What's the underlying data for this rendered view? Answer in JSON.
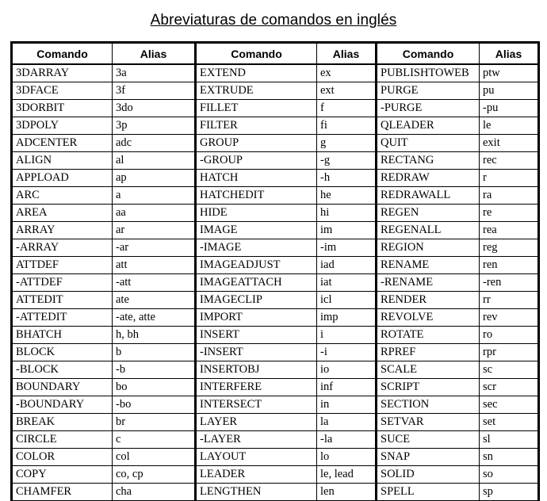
{
  "page": {
    "title": "Abreviaturas de comandos en inglés",
    "background_color": "#ffffff",
    "text_color": "#000000",
    "border_color": "#000000"
  },
  "table": {
    "headers": {
      "command": "Comando",
      "alias": "Alias"
    },
    "column_groups": [
      {
        "group_index": 1,
        "header_command": "Comando",
        "header_alias": "Alias",
        "rows": [
          {
            "command": "3DARRAY",
            "alias": "3a"
          },
          {
            "command": "3DFACE",
            "alias": "3f"
          },
          {
            "command": "3DORBIT",
            "alias": "3do"
          },
          {
            "command": "3DPOLY",
            "alias": "3p"
          },
          {
            "command": "ADCENTER",
            "alias": "adc"
          },
          {
            "command": "ALIGN",
            "alias": "al"
          },
          {
            "command": "APPLOAD",
            "alias": "ap"
          },
          {
            "command": "ARC",
            "alias": "a"
          },
          {
            "command": "AREA",
            "alias": "aa"
          },
          {
            "command": "ARRAY",
            "alias": "ar"
          },
          {
            "command": "-ARRAY",
            "alias": "-ar"
          },
          {
            "command": "ATTDEF",
            "alias": "att"
          },
          {
            "command": "-ATTDEF",
            "alias": "-att"
          },
          {
            "command": "ATTEDIT",
            "alias": "ate"
          },
          {
            "command": "-ATTEDIT",
            "alias": "-ate, atte"
          },
          {
            "command": "BHATCH",
            "alias": "h, bh"
          },
          {
            "command": "BLOCK",
            "alias": "b"
          },
          {
            "command": "-BLOCK",
            "alias": "-b"
          },
          {
            "command": "BOUNDARY",
            "alias": "bo"
          },
          {
            "command": "-BOUNDARY",
            "alias": "-bo"
          },
          {
            "command": "BREAK",
            "alias": "br"
          },
          {
            "command": "CIRCLE",
            "alias": "c"
          },
          {
            "command": "COLOR",
            "alias": "col"
          },
          {
            "command": "COPY",
            "alias": "co, cp"
          },
          {
            "command": "CHAMFER",
            "alias": "cha"
          }
        ]
      },
      {
        "group_index": 2,
        "header_command": "Comando",
        "header_alias": "Alias",
        "rows": [
          {
            "command": "EXTEND",
            "alias": "ex"
          },
          {
            "command": "EXTRUDE",
            "alias": "ext"
          },
          {
            "command": "FILLET",
            "alias": "f"
          },
          {
            "command": "FILTER",
            "alias": "fi"
          },
          {
            "command": "GROUP",
            "alias": "g"
          },
          {
            "command": "-GROUP",
            "alias": "-g"
          },
          {
            "command": "HATCH",
            "alias": "-h"
          },
          {
            "command": "HATCHEDIT",
            "alias": "he"
          },
          {
            "command": "HIDE",
            "alias": "hi"
          },
          {
            "command": "IMAGE",
            "alias": "im"
          },
          {
            "command": "-IMAGE",
            "alias": "-im"
          },
          {
            "command": "IMAGEADJUST",
            "alias": "iad"
          },
          {
            "command": "IMAGEATTACH",
            "alias": "iat"
          },
          {
            "command": "IMAGECLIP",
            "alias": "icl"
          },
          {
            "command": "IMPORT",
            "alias": "imp"
          },
          {
            "command": "INSERT",
            "alias": "i"
          },
          {
            "command": "-INSERT",
            "alias": "-i"
          },
          {
            "command": "INSERTOBJ",
            "alias": "io"
          },
          {
            "command": "INTERFERE",
            "alias": "inf"
          },
          {
            "command": "INTERSECT",
            "alias": "in"
          },
          {
            "command": "LAYER",
            "alias": "la"
          },
          {
            "command": "-LAYER",
            "alias": "-la"
          },
          {
            "command": "LAYOUT",
            "alias": "lo"
          },
          {
            "command": "LEADER",
            "alias": "le, lead"
          },
          {
            "command": "LENGTHEN",
            "alias": "len"
          }
        ]
      },
      {
        "group_index": 3,
        "header_command": "Comando",
        "header_alias": "Alias",
        "rows": [
          {
            "command": "PUBLISHTOWEB",
            "alias": "ptw"
          },
          {
            "command": "PURGE",
            "alias": "pu"
          },
          {
            "command": "-PURGE",
            "alias": "-pu"
          },
          {
            "command": "QLEADER",
            "alias": "le"
          },
          {
            "command": "QUIT",
            "alias": "exit"
          },
          {
            "command": "RECTANG",
            "alias": "rec"
          },
          {
            "command": "REDRAW",
            "alias": "r"
          },
          {
            "command": "REDRAWALL",
            "alias": "ra"
          },
          {
            "command": "REGEN",
            "alias": "re"
          },
          {
            "command": "REGENALL",
            "alias": "rea"
          },
          {
            "command": "REGION",
            "alias": "reg"
          },
          {
            "command": "RENAME",
            "alias": "ren"
          },
          {
            "command": "-RENAME",
            "alias": "-ren"
          },
          {
            "command": "RENDER",
            "alias": "rr"
          },
          {
            "command": "REVOLVE",
            "alias": "rev"
          },
          {
            "command": "ROTATE",
            "alias": "ro"
          },
          {
            "command": "RPREF",
            "alias": "rpr"
          },
          {
            "command": "SCALE",
            "alias": "sc"
          },
          {
            "command": "SCRIPT",
            "alias": "scr"
          },
          {
            "command": "SECTION",
            "alias": "sec"
          },
          {
            "command": "SETVAR",
            "alias": "set"
          },
          {
            "command": "SUCE",
            "alias": "sl"
          },
          {
            "command": "SNAP",
            "alias": "sn"
          },
          {
            "command": "SOLID",
            "alias": "so"
          },
          {
            "command": "SPELL",
            "alias": "sp"
          }
        ]
      }
    ]
  }
}
